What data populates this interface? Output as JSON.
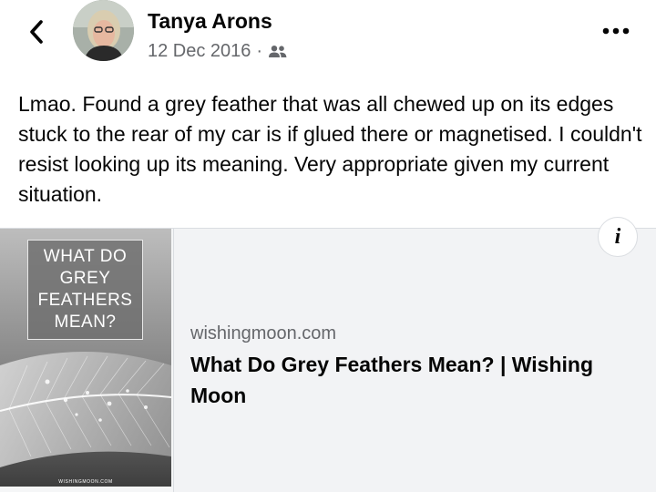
{
  "post": {
    "author": "Tanya Arons",
    "date": "12 Dec 2016",
    "separator": "·",
    "audience_icon": "friends-icon",
    "text": "Lmao. Found a grey feather that was all chewed up on its edges stuck to the rear of my car is if glued there or magnetised.  I couldn't resist looking up its meaning.  Very appropriate given my current situation."
  },
  "header": {
    "back_icon": "chevron-left-icon",
    "more_icon": "more-horizontal-icon"
  },
  "link_preview": {
    "thumbnail_title": "WHAT DO GREY FEATHERS MEAN?",
    "thumbnail_footer": "WISHINGMOON.COM",
    "domain": "wishingmoon.com",
    "title": "What Do Grey Feathers Mean? | Wishing Moon",
    "info_label": "i"
  },
  "colors": {
    "text_primary": "#050505",
    "text_secondary": "#65676b",
    "card_background": "#f2f3f5",
    "border": "#dadde1"
  }
}
